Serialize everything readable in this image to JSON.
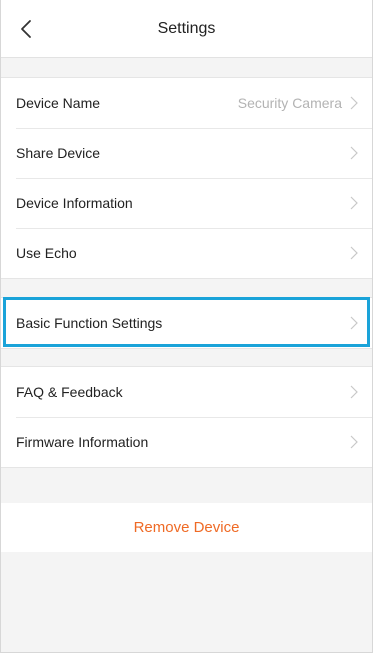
{
  "header": {
    "title": "Settings",
    "back_icon": "chevron-left-icon"
  },
  "group1": {
    "items": [
      {
        "label": "Device Name",
        "value": "Security Camera"
      },
      {
        "label": "Share Device"
      },
      {
        "label": "Device Information"
      },
      {
        "label": "Use Echo"
      }
    ]
  },
  "group2": {
    "items": [
      {
        "label": "Basic Function Settings"
      }
    ]
  },
  "group3": {
    "items": [
      {
        "label": "FAQ & Feedback"
      },
      {
        "label": "Firmware Information"
      }
    ]
  },
  "remove": {
    "label": "Remove Device"
  },
  "colors": {
    "accent": "#ef6a25",
    "highlight": "#1aa3d9",
    "chevron": "#c8c8c8",
    "value_text": "#b3b3b3",
    "background": "#f4f4f4"
  }
}
